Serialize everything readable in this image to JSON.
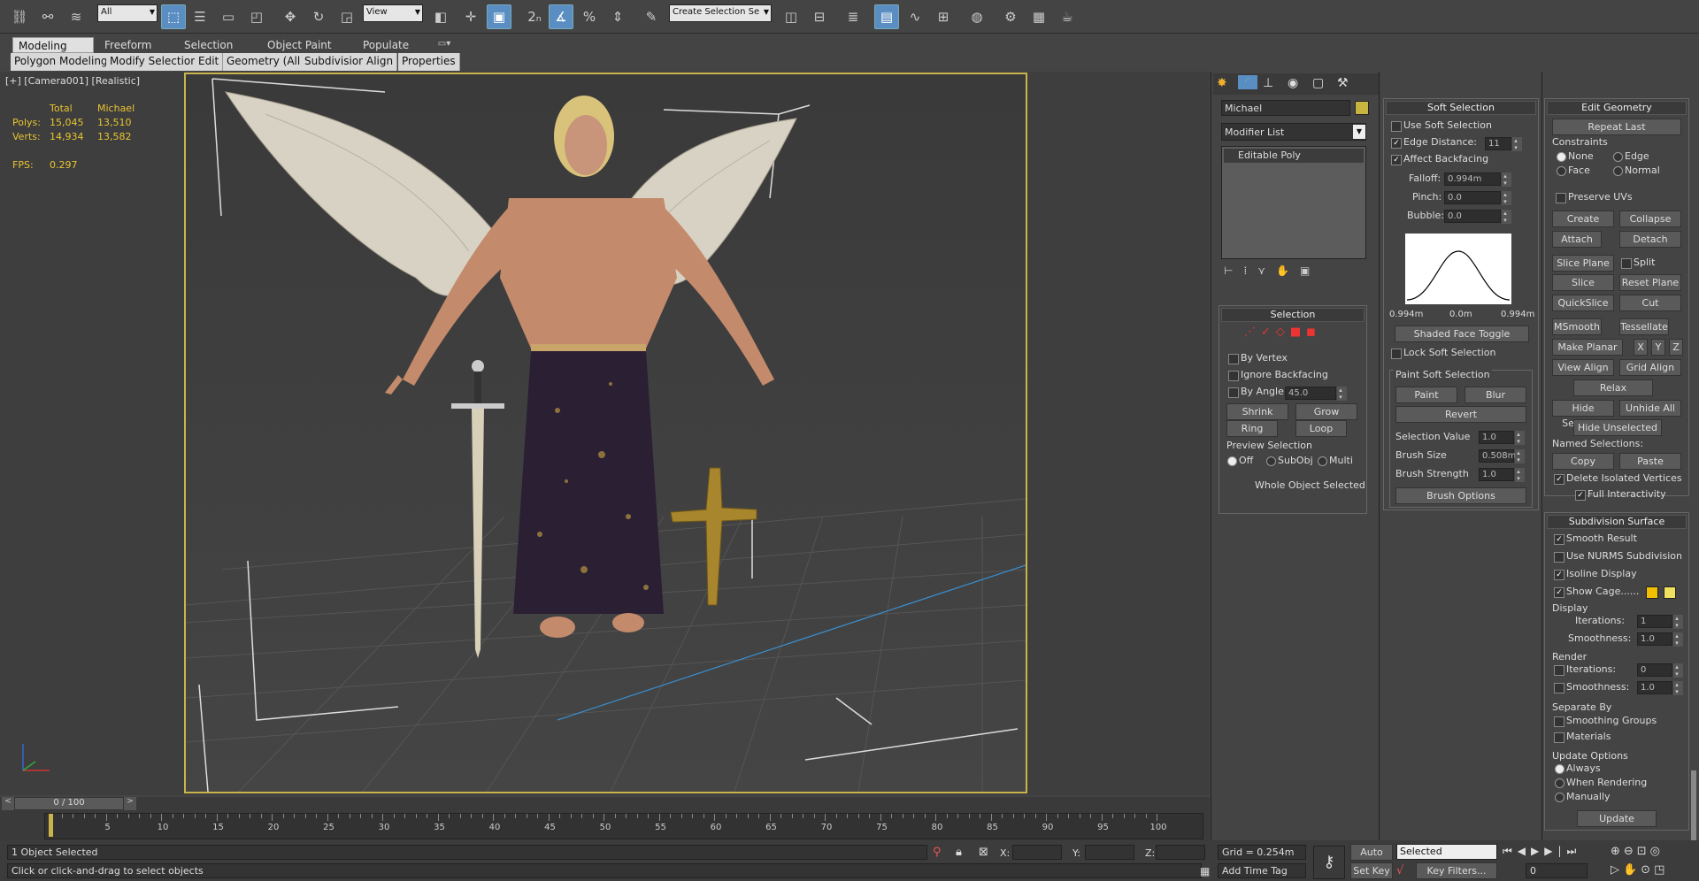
{
  "toolbar": {
    "filter_select": "All",
    "refcoord_select": "View",
    "selection_set_field": "Create Selection Se"
  },
  "ribbon": {
    "tabs": [
      "Modeling",
      "Freeform",
      "Selection",
      "Object Paint",
      "Populate"
    ],
    "subtabs": [
      "Polygon Modeling",
      "Modify Selection",
      "Edit",
      "Geometry (All)",
      "Subdivision",
      "Align",
      "Properties"
    ]
  },
  "viewport": {
    "label": "[+] [Camera001] [Realistic]",
    "stats": {
      "col_total": "Total",
      "col_obj": "Michael",
      "polys_label": "Polys:",
      "polys_total": "15,045",
      "polys_obj": "13,510",
      "verts_label": "Verts:",
      "verts_total": "14,934",
      "verts_obj": "13,582",
      "fps_label": "FPS:",
      "fps_value": "0.297"
    }
  },
  "timeline": {
    "frame_counter": "0 / 100",
    "ticks": [
      "5",
      "10",
      "15",
      "20",
      "25",
      "30",
      "35",
      "40",
      "45",
      "50",
      "55",
      "60",
      "65",
      "70",
      "75",
      "80",
      "85",
      "90",
      "95",
      "100"
    ]
  },
  "status": {
    "selected_text": "1 Object Selected",
    "prompt_text": "Click or click-and-drag to select objects",
    "x_label": "X:",
    "y_label": "Y:",
    "z_label": "Z:",
    "grid_text": "Grid = 0.254m",
    "add_time_tag": "Add Time Tag",
    "auto_key": "Auto Key",
    "set_key": "Set Key",
    "selected_dropdown": "Selected",
    "key_filters": "Key Filters...",
    "frame_value": "0"
  },
  "modify": {
    "object_name": "Michael",
    "modifier_list": "Modifier List",
    "stack_item": "Editable Poly",
    "selection": {
      "title": "Selection",
      "by_vertex": "By Vertex",
      "ignore_backfacing": "Ignore Backfacing",
      "by_angle": "By Angle:",
      "angle_value": "45.0",
      "shrink": "Shrink",
      "grow": "Grow",
      "ring": "Ring",
      "loop": "Loop",
      "preview_selection": "Preview Selection",
      "off": "Off",
      "subobj": "SubObj",
      "multi": "Multi",
      "whole_object": "Whole Object Selected"
    }
  },
  "soft_selection": {
    "title": "Soft Selection",
    "use_soft": "Use Soft Selection",
    "edge_distance": "Edge Distance:",
    "edge_value": "11",
    "affect_backfacing": "Affect Backfacing",
    "falloff": "Falloff:",
    "falloff_value": "0.994m",
    "pinch": "Pinch:",
    "pinch_value": "0.0",
    "bubble": "Bubble:",
    "bubble_value": "0.0",
    "curve_left": "0.994m",
    "curve_mid": "0.0m",
    "curve_right": "0.994m",
    "shaded_face_toggle": "Shaded Face Toggle",
    "lock_soft": "Lock Soft Selection",
    "paint_soft": "Paint Soft Selection",
    "paint": "Paint",
    "blur": "Blur",
    "revert": "Revert",
    "selection_value": "Selection Value",
    "selection_value_num": "1.0",
    "brush_size": "Brush Size",
    "brush_size_num": "0.508m",
    "brush_strength": "Brush Strength",
    "brush_strength_num": "1.0",
    "brush_options": "Brush Options"
  },
  "edit_geometry": {
    "title": "Edit Geometry",
    "repeat_last": "Repeat Last",
    "constraints": "Constraints",
    "none": "None",
    "edge": "Edge",
    "face": "Face",
    "normal": "Normal",
    "preserve_uvs": "Preserve UVs",
    "create": "Create",
    "collapse": "Collapse",
    "attach": "Attach",
    "detach": "Detach",
    "slice_plane": "Slice Plane",
    "split": "Split",
    "slice": "Slice",
    "reset_plane": "Reset Plane",
    "quickslice": "QuickSlice",
    "cut": "Cut",
    "msmooth": "MSmooth",
    "tessellate": "Tessellate",
    "make_planar": "Make Planar",
    "x": "X",
    "y": "Y",
    "z": "Z",
    "view_align": "View Align",
    "grid_align": "Grid Align",
    "relax": "Relax",
    "hide_selected": "Hide Selected",
    "unhide_all": "Unhide All",
    "hide_unselected": "Hide Unselected",
    "named_selections": "Named Selections:",
    "copy": "Copy",
    "paste": "Paste",
    "delete_isolated": "Delete Isolated Vertices",
    "full_interactivity": "Full Interactivity"
  },
  "subdivision": {
    "title": "Subdivision Surface",
    "smooth_result": "Smooth Result",
    "use_nurms": "Use NURMS Subdivision",
    "isoline": "Isoline Display",
    "show_cage": "Show Cage......",
    "display": "Display",
    "iterations": "Iterations:",
    "iterations_val": "1",
    "smoothness": "Smoothness:",
    "smoothness_val": "1.0",
    "render": "Render",
    "r_iterations_val": "0",
    "r_smoothness_val": "1.0",
    "separate_by": "Separate By",
    "smoothing_groups": "Smoothing Groups",
    "materials": "Materials",
    "update_options": "Update Options",
    "always": "Always",
    "when_rendering": "When Rendering",
    "manually": "Manually",
    "update": "Update"
  },
  "colors": {
    "accent": "#5a8ec2",
    "viewport_border": "#c8b44a",
    "stats_text": "#e8c430",
    "object_color": "#c8b440"
  }
}
